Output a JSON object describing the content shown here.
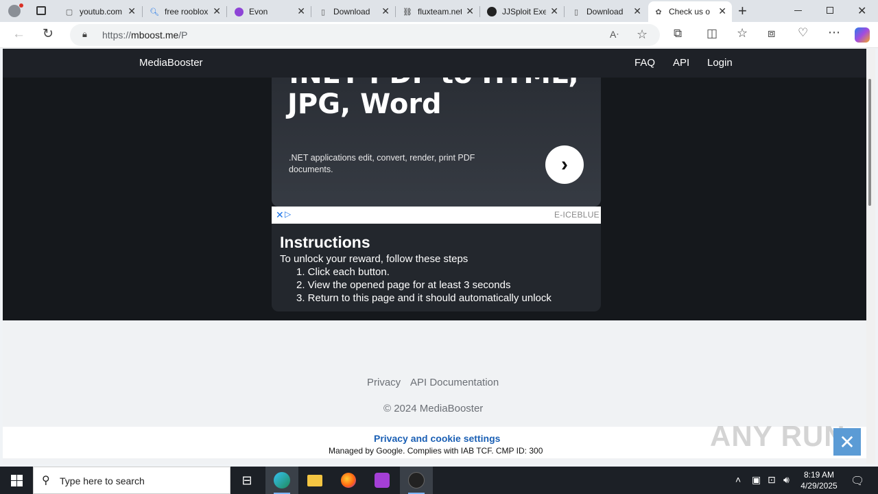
{
  "browser": {
    "tabs": [
      {
        "title": "youtub.com",
        "icon": "page-icon"
      },
      {
        "title": "free rooblox",
        "icon": "search-icon"
      },
      {
        "title": "Evon",
        "icon": "evon-icon"
      },
      {
        "title": "Download",
        "icon": "page-icon"
      },
      {
        "title": "fluxteam.net",
        "icon": "flux-icon"
      },
      {
        "title": "JJSploit Executor",
        "icon": "jjsploit-icon"
      },
      {
        "title": "Download",
        "icon": "page-icon"
      },
      {
        "title": "Check us o",
        "icon": "mboost-icon",
        "active": true
      }
    ],
    "new_tab_symbol": "+",
    "url_prefix": "https://",
    "url_host": "mboost.me",
    "url_path": "/P"
  },
  "site": {
    "brand": "MediaBooster",
    "nav": [
      {
        "label": "FAQ"
      },
      {
        "label": "API"
      },
      {
        "label": "Login"
      }
    ]
  },
  "ad": {
    "headline_line1": ".NET PDF to HTML,",
    "headline_line2": "JPG, Word",
    "description": ".NET applications edit, convert, render, print PDF documents.",
    "arrow": "›",
    "advertiser": "E-ICEBLUE"
  },
  "instructions": {
    "title": "Instructions",
    "subtitle": "To unlock your reward, follow these steps",
    "steps": [
      "1. Click each button.",
      "2. View the opened page for at least 3 seconds",
      "3. Return to this page and it should automatically unlock"
    ]
  },
  "footer": {
    "links": [
      {
        "label": "Privacy"
      },
      {
        "label": "API Documentation"
      }
    ],
    "copyright": "© 2024 MediaBooster"
  },
  "consent": {
    "link": "Privacy and cookie settings",
    "note": "Managed by Google. Complies with IAB TCF. CMP ID: 300"
  },
  "watermark": "ANY RUN",
  "taskbar": {
    "search_placeholder": "Type here to search",
    "time": "8:19 AM",
    "date": "4/29/2025"
  }
}
